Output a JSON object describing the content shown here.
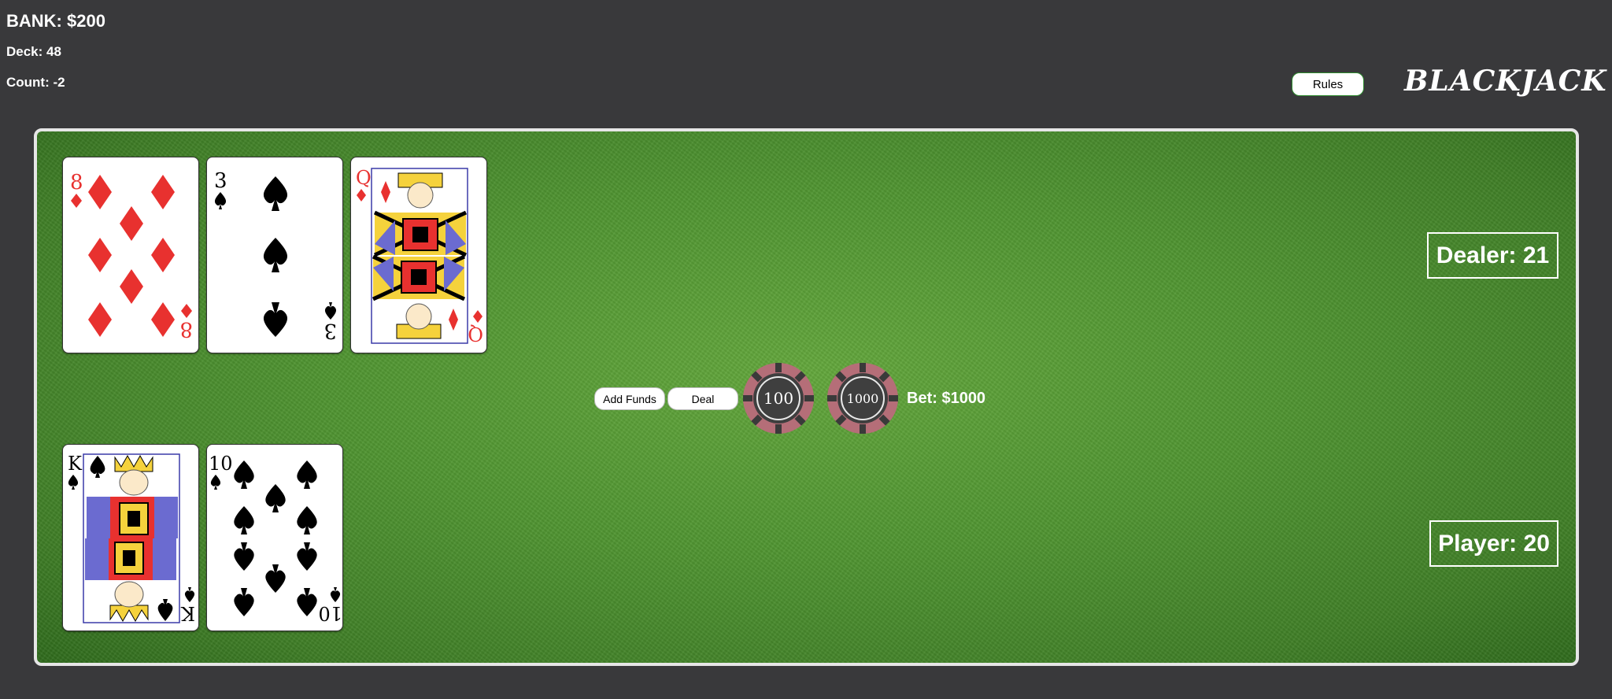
{
  "header": {
    "bank": "BANK: $200",
    "deck": "Deck: 48",
    "count": "Count: -2",
    "rules_label": "Rules",
    "title": "BLACKJACK"
  },
  "table": {
    "dealer_score": "Dealer: 21",
    "player_score": "Player: 20",
    "add_funds_label": "Add Funds",
    "deal_label": "Deal",
    "chips": [
      "100",
      "1000"
    ],
    "bet": "Bet: $1000"
  },
  "dealer_cards": [
    {
      "rank": "8",
      "suit": "diamonds"
    },
    {
      "rank": "3",
      "suit": "spades"
    },
    {
      "rank": "Q",
      "suit": "diamonds"
    }
  ],
  "player_cards": [
    {
      "rank": "K",
      "suit": "spades"
    },
    {
      "rank": "10",
      "suit": "spades"
    }
  ],
  "colors": {
    "felt": "#4f9431",
    "background": "#39393b",
    "red_suit": "#e8312f",
    "black_suit": "#000000",
    "chip_ring": "#b56e78"
  }
}
